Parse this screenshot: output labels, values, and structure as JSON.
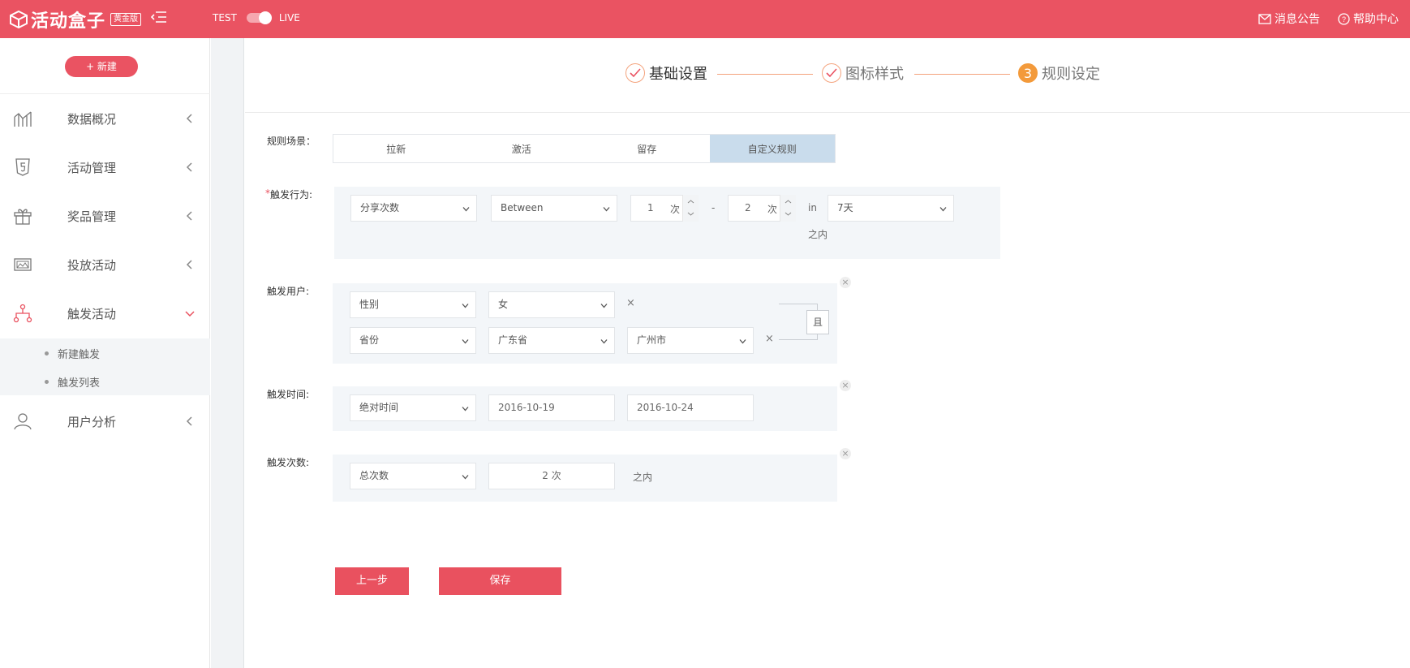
{
  "topbar": {
    "logo_text": "活动盒子",
    "logo_badge": "黄金版",
    "env_test": "TEST",
    "env_live": "LIVE",
    "message_label": "消息公告",
    "help_label": "帮助中心",
    "brand_color": "#ea5362"
  },
  "sidebar": {
    "new_button": "+ 新建",
    "items": [
      {
        "label": "数据概况",
        "icon": "chart-icon"
      },
      {
        "label": "活动管理",
        "icon": "html5-icon"
      },
      {
        "label": "奖品管理",
        "icon": "gift-icon"
      },
      {
        "label": "投放活动",
        "icon": "image-icon"
      },
      {
        "label": "触发活动",
        "icon": "hierarchy-icon",
        "expanded": true
      },
      {
        "label": "用户分析",
        "icon": "user-icon"
      }
    ],
    "subitems": [
      {
        "label": "新建触发"
      },
      {
        "label": "触发列表"
      }
    ]
  },
  "steps": [
    {
      "label": "基础设置",
      "state": "done"
    },
    {
      "label": "图标样式",
      "state": "done"
    },
    {
      "label": "规则设定",
      "number": "3",
      "state": "active"
    }
  ],
  "form": {
    "scene_label": "规则场景：",
    "scene_tabs": [
      {
        "label": "拉新"
      },
      {
        "label": "激活"
      },
      {
        "label": "留存"
      },
      {
        "label": "自定义规则",
        "active": true
      }
    ],
    "behavior": {
      "required_mark": "*",
      "label": "触发行为:",
      "action": "分享次数",
      "operator": "Between",
      "min": "1",
      "max": "2",
      "unit": "次",
      "dash": "-",
      "in_text": "in",
      "period": "7天",
      "within": "之内"
    },
    "users": {
      "label": "触发用户:",
      "row1": {
        "field": "性别",
        "value": "女"
      },
      "row2": {
        "field": "省份",
        "value": "广东省",
        "city": "广州市"
      },
      "remove": "×",
      "logic": "且",
      "close": "×"
    },
    "time": {
      "label": "触发时间:",
      "type": "绝对时间",
      "start": "2016-10-19",
      "end": "2016-10-24",
      "close": "×"
    },
    "count": {
      "label": "触发次数:",
      "type": "总次数",
      "value": "2 次",
      "within": "之内",
      "close": "×"
    },
    "prev_button": "上一步",
    "save_button": "保存"
  }
}
